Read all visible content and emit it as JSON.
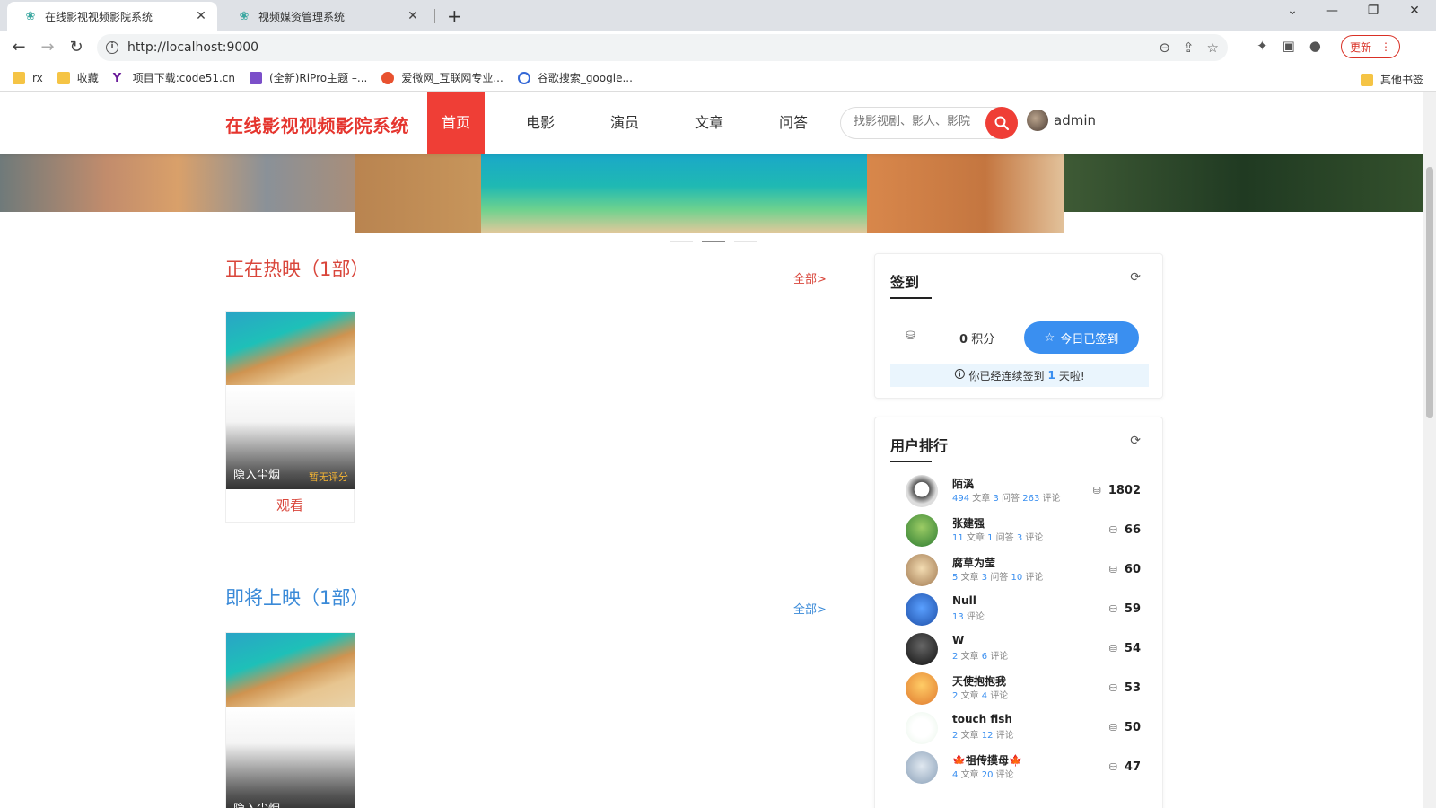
{
  "browser": {
    "tabs": [
      {
        "title": "在线影视视频影院系统",
        "active": true
      },
      {
        "title": "视频媒资管理系统",
        "active": false
      }
    ],
    "url": "http://localhost:9000",
    "update_label": "更新",
    "bookmarks": [
      {
        "label": "rx",
        "icon": "folder-icon"
      },
      {
        "label": "收藏",
        "icon": "folder-icon"
      },
      {
        "label": "项目下载:code51.cn",
        "icon": "site-icon"
      },
      {
        "label": "(全新)RiPro主题 –...",
        "icon": "site-icon"
      },
      {
        "label": "爱微网_互联网专业...",
        "icon": "site-icon"
      },
      {
        "label": "谷歌搜索_google...",
        "icon": "site-icon"
      }
    ],
    "other_bookmarks": "其他书签"
  },
  "header": {
    "logo": "在线影视视频影院系统",
    "nav": [
      "首页",
      "电影",
      "演员",
      "文章",
      "问答"
    ],
    "search_placeholder": "找影视剧、影人、影院",
    "username": "admin"
  },
  "now_showing": {
    "title": "正在热映（1部）",
    "more": "全部>",
    "movie": {
      "name": "隐入尘烟",
      "score": "暂无评分",
      "watch": "观看"
    }
  },
  "coming_soon": {
    "title": "即将上映（1部）",
    "more": "全部>",
    "movie": {
      "name": "隐入尘烟"
    }
  },
  "signin": {
    "title": "签到",
    "points_value": "0",
    "points_unit": "积分",
    "button": "今日已签到",
    "streak_prefix": "你已经连续签到",
    "streak_days": "1",
    "streak_suffix": "天啦!"
  },
  "ranking": {
    "title": "用户排行",
    "users": [
      {
        "name": "陌溪",
        "stats": [
          [
            "494",
            "文章"
          ],
          [
            "3",
            "问答"
          ],
          [
            "263",
            "评论"
          ]
        ],
        "score": "1802"
      },
      {
        "name": "张建强",
        "stats": [
          [
            "11",
            "文章"
          ],
          [
            "1",
            "问答"
          ],
          [
            "3",
            "评论"
          ]
        ],
        "score": "66"
      },
      {
        "name": "腐草为莹",
        "stats": [
          [
            "5",
            "文章"
          ],
          [
            "3",
            "问答"
          ],
          [
            "10",
            "评论"
          ]
        ],
        "score": "60"
      },
      {
        "name": "Null",
        "stats": [
          [
            "13",
            "评论"
          ]
        ],
        "score": "59"
      },
      {
        "name": "W",
        "stats": [
          [
            "2",
            "文章"
          ],
          [
            "6",
            "评论"
          ]
        ],
        "score": "54"
      },
      {
        "name": "天使抱抱我",
        "stats": [
          [
            "2",
            "文章"
          ],
          [
            "4",
            "评论"
          ]
        ],
        "score": "53"
      },
      {
        "name": "touch fish",
        "stats": [
          [
            "2",
            "文章"
          ],
          [
            "12",
            "评论"
          ]
        ],
        "score": "50"
      },
      {
        "name": "🍁祖传摸母🍁",
        "stats": [
          [
            "4",
            "文章"
          ],
          [
            "20",
            "评论"
          ]
        ],
        "score": "47"
      }
    ]
  },
  "colors": {
    "brand_red": "#ef3e36",
    "accent_blue": "#3a8ff0"
  }
}
